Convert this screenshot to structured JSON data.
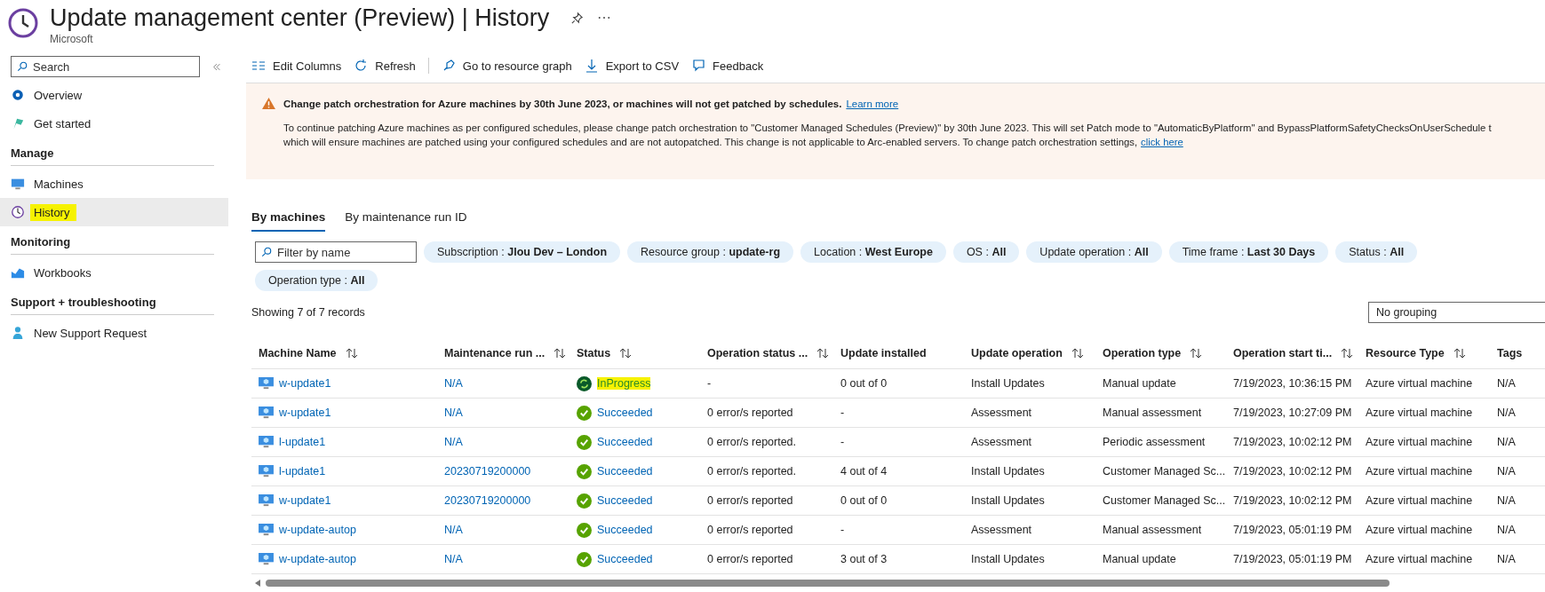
{
  "header": {
    "title": "Update management center (Preview) | History",
    "subtitle": "Microsoft"
  },
  "sidebar": {
    "search": {
      "placeholder": "Search"
    },
    "items": [
      {
        "kind": "item",
        "label": "Overview",
        "selected": false,
        "highlighted": false
      },
      {
        "kind": "item",
        "label": "Get started",
        "selected": false,
        "highlighted": false
      },
      {
        "kind": "section",
        "label": "Manage"
      },
      {
        "kind": "item",
        "label": "Machines",
        "selected": false,
        "highlighted": false
      },
      {
        "kind": "item",
        "label": "History",
        "selected": true,
        "highlighted": true
      },
      {
        "kind": "section",
        "label": "Monitoring"
      },
      {
        "kind": "item",
        "label": "Workbooks",
        "selected": false,
        "highlighted": false
      },
      {
        "kind": "section",
        "label": "Support + troubleshooting"
      },
      {
        "kind": "item",
        "label": "New Support Request",
        "selected": false,
        "highlighted": false
      }
    ]
  },
  "toolbar": [
    {
      "label": "Edit Columns"
    },
    {
      "label": "Refresh"
    },
    {
      "label": "Go to resource graph"
    },
    {
      "label": "Export to CSV"
    },
    {
      "label": "Feedback"
    }
  ],
  "banner": {
    "title": "Change patch orchestration for Azure machines by 30th June 2023, or machines will not get patched by schedules.",
    "title_link": "Learn more",
    "lines": [
      "To continue patching Azure machines as per configured schedules, please change patch orchestration to \"Customer Managed Schedules (Preview)\" by 30th June 2023. This will set Patch mode to \"AutomaticByPlatform\" and BypassPlatformSafetyChecksOnUserSchedule t",
      "which will ensure machines are patched using your configured schedules and are not autopatched. This change is not applicable to Arc-enabled servers. To change patch orchestration settings,"
    ],
    "body_link": "click here"
  },
  "tabs": [
    {
      "label": "By machines",
      "selected": true
    },
    {
      "label": "By maintenance run ID",
      "selected": false
    }
  ],
  "filter": {
    "placeholder": "Filter by name"
  },
  "filters": [
    "Subscription : **Jlou Dev – London**",
    "Resource group : **update-rg**",
    "Location : **West Europe**",
    "OS : **All**",
    "Update operation : **All**",
    "Time frame : **Last 30 Days**",
    "Status : **All**",
    "Operation type : **All**"
  ],
  "record_count": "Showing 7 of 7 records",
  "grouping": {
    "value": "No grouping"
  },
  "table": {
    "columns": [
      {
        "label": "Machine Name",
        "sortable": true
      },
      {
        "label": "Maintenance run ...",
        "sortable": true
      },
      {
        "label": "Status",
        "sortable": true
      },
      {
        "label": "Operation status ...",
        "sortable": true
      },
      {
        "label": "Update installed",
        "sortable": false
      },
      {
        "label": "Update operation",
        "sortable": true
      },
      {
        "label": "Operation type",
        "sortable": true
      },
      {
        "label": "Operation start ti...",
        "sortable": true
      },
      {
        "label": "Resource Type",
        "sortable": true
      },
      {
        "label": "Tags",
        "sortable": false
      }
    ],
    "rows": [
      {
        "machine": "w-update1",
        "run": "N/A",
        "status": {
          "kind": "in_progress",
          "label": "InProgress",
          "highlighted": true
        },
        "op_status": "-",
        "installed": "0 out of 0",
        "update_op": "Install Updates",
        "op_type": "Manual update",
        "start": "7/19/2023, 10:36:15 PM",
        "resource": "Azure virtual machine",
        "tags": "N/A"
      },
      {
        "machine": "w-update1",
        "run": "N/A",
        "status": {
          "kind": "succeeded",
          "label": "Succeeded",
          "highlighted": false
        },
        "op_status": "0 error/s reported",
        "installed": "-",
        "update_op": "Assessment",
        "op_type": "Manual assessment",
        "start": "7/19/2023, 10:27:09 PM",
        "resource": "Azure virtual machine",
        "tags": "N/A"
      },
      {
        "machine": "l-update1",
        "run": "N/A",
        "status": {
          "kind": "succeeded",
          "label": "Succeeded",
          "highlighted": false
        },
        "op_status": "0 error/s reported.",
        "installed": "-",
        "update_op": "Assessment",
        "op_type": "Periodic assessment",
        "start": "7/19/2023, 10:02:12 PM",
        "resource": "Azure virtual machine",
        "tags": "N/A"
      },
      {
        "machine": "l-update1",
        "run": "20230719200000",
        "status": {
          "kind": "succeeded",
          "label": "Succeeded",
          "highlighted": false
        },
        "op_status": "0 error/s reported.",
        "installed": "4 out of 4",
        "update_op": "Install Updates",
        "op_type": "Customer Managed Sc...",
        "start": "7/19/2023, 10:02:12 PM",
        "resource": "Azure virtual machine",
        "tags": "N/A"
      },
      {
        "machine": "w-update1",
        "run": "20230719200000",
        "status": {
          "kind": "succeeded",
          "label": "Succeeded",
          "highlighted": false
        },
        "op_status": "0 error/s reported",
        "installed": "0 out of 0",
        "update_op": "Install Updates",
        "op_type": "Customer Managed Sc...",
        "start": "7/19/2023, 10:02:12 PM",
        "resource": "Azure virtual machine",
        "tags": "N/A"
      },
      {
        "machine": "w-update-autop",
        "run": "N/A",
        "status": {
          "kind": "succeeded",
          "label": "Succeeded",
          "highlighted": false
        },
        "op_status": "0 error/s reported",
        "installed": "-",
        "update_op": "Assessment",
        "op_type": "Manual assessment",
        "start": "7/19/2023, 05:01:19 PM",
        "resource": "Azure virtual machine",
        "tags": "N/A"
      },
      {
        "machine": "w-update-autop",
        "run": "N/A",
        "status": {
          "kind": "succeeded",
          "label": "Succeeded",
          "highlighted": false
        },
        "op_status": "0 error/s reported",
        "installed": "3 out of 3",
        "update_op": "Install Updates",
        "op_type": "Manual update",
        "start": "7/19/2023, 05:01:19 PM",
        "resource": "Azure virtual machine",
        "tags": "N/A"
      }
    ]
  }
}
